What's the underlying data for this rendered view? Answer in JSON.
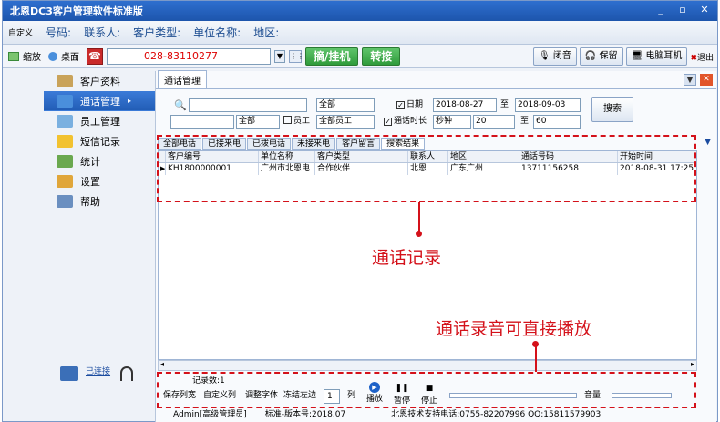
{
  "title": "北恩DC3客户管理软件标准版",
  "infobar": {
    "custom": "自定义",
    "fields": [
      "号码:",
      "联系人:",
      "客户类型:",
      "单位名称:",
      "地区:"
    ]
  },
  "toolbar": {
    "shrink": "缩放",
    "desktop": "桌面",
    "phone": "028-83110277",
    "hook": "摘/挂机",
    "transfer": "转接",
    "mute": "闭音",
    "hold": "保留",
    "headset": "电脑耳机",
    "exit": "退出"
  },
  "sidebar": [
    {
      "label": "客户资料",
      "icon": "customer-icon"
    },
    {
      "label": "通话管理",
      "icon": "call-icon",
      "active": true
    },
    {
      "label": "员工管理",
      "icon": "staff-icon"
    },
    {
      "label": "短信记录",
      "icon": "sms-icon"
    },
    {
      "label": "统计",
      "icon": "chart-icon"
    },
    {
      "label": "设置",
      "icon": "settings-icon"
    },
    {
      "label": "帮助",
      "icon": "help-icon"
    }
  ],
  "tab": "通话管理",
  "filter": {
    "all1": "全部",
    "date_label": "日期",
    "date_from": "2018-08-27",
    "to": "至",
    "date_to": "2018-09-03",
    "all2": "全部",
    "staff_label": "员工",
    "all_staff": "全部员工",
    "duration_label": "通话时长",
    "unit": "秒钟",
    "dur_from": "20",
    "dur_to": "60",
    "search": "搜索"
  },
  "subtabs": [
    "全部电话",
    "已接来电",
    "已拨电话",
    "未接来电",
    "客户留言",
    "搜索结果"
  ],
  "grid": {
    "headers": [
      "客户编号",
      "单位名称",
      "客户类型",
      "联系人",
      "地区",
      "通话号码",
      "开始时间"
    ],
    "rows": [
      [
        "KH1800000001",
        "广州市北恩电",
        "合作伙伴",
        "北恩",
        "广东广州",
        "13711156258",
        "2018-08-31 17:25"
      ]
    ]
  },
  "bottom": {
    "count": "记录数:1",
    "save_width": "保存列宽",
    "custom_cols": "自定义列",
    "font": "调整字体",
    "freeze": "冻结左边",
    "freeze_n": "1",
    "col": "列",
    "play": "播放",
    "pause": "暂停",
    "stop": "停止",
    "volume": "音量:"
  },
  "status": {
    "user": "Admin[高级管理员]",
    "version": "标准-版本号:2018.07",
    "support": "北恩技术支持电话:0755-82207996 QQ:15811579903"
  },
  "connected": "已连接",
  "annotations": {
    "calls": "通话记录",
    "play": "通话录音可直接播放"
  }
}
